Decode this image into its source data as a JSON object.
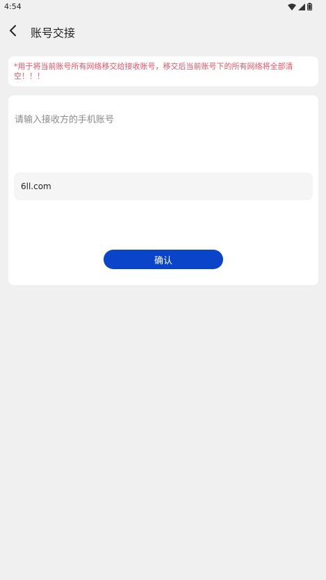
{
  "status_bar": {
    "time": "4:54",
    "icons": [
      "wifi-icon",
      "signal-icon",
      "battery-icon"
    ]
  },
  "header": {
    "back_icon": "chevron-left-icon",
    "title": "账号交接"
  },
  "warning": {
    "text": "*用于将当前账号所有网络移交给接收账号，移交后当前账号下的所有网络将全部清空！！！",
    "color": "#e0546a"
  },
  "form": {
    "label": "请输入接收方的手机账号",
    "account_input": {
      "value": "6ll.com",
      "placeholder": ""
    },
    "confirm_label": "确认"
  },
  "colors": {
    "background": "#f0f0f0",
    "card": "#ffffff",
    "accent": "#0a45c9",
    "input_bg": "#f5f5f5"
  }
}
